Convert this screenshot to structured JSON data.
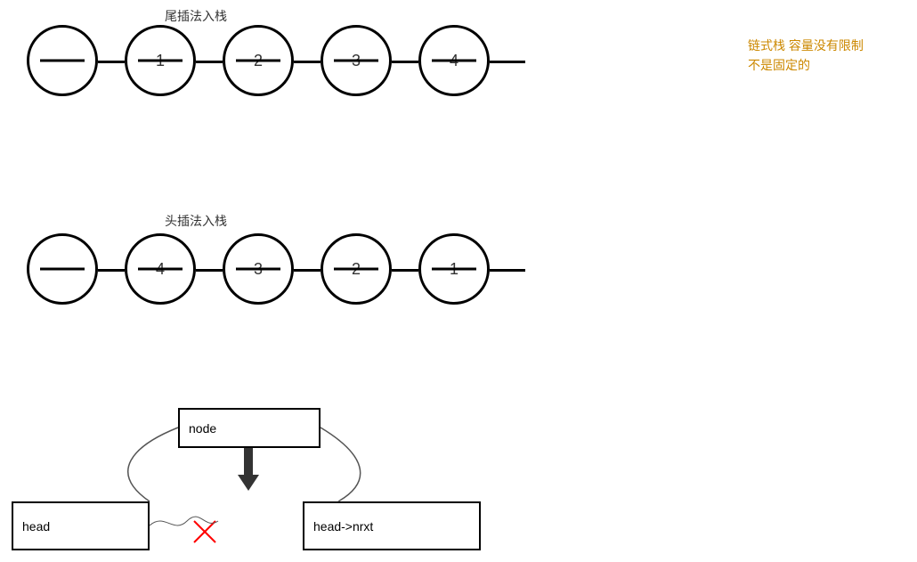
{
  "title1": "尾插法入栈",
  "title2": "头插法入栈",
  "annotation": {
    "line1": "链式栈 容量没有限制",
    "line2": "不是固定的"
  },
  "row1": {
    "nodes": [
      "",
      "1",
      "2",
      "3",
      "4"
    ]
  },
  "row2": {
    "nodes": [
      "",
      "4",
      "3",
      "2",
      "1"
    ]
  },
  "diagram": {
    "node_label": "node",
    "head_label": "head",
    "next_label": "head->nrxt"
  }
}
